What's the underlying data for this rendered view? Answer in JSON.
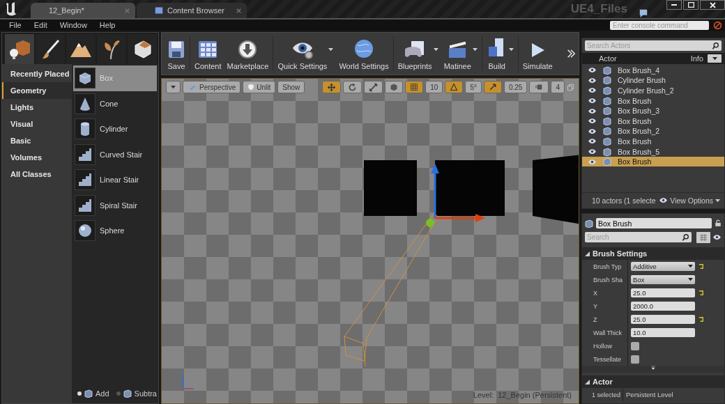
{
  "window": {
    "tabs": [
      {
        "label": "12_Begin*",
        "kind": "level",
        "selected": true
      },
      {
        "label": "Content Browser",
        "kind": "content",
        "selected": false
      }
    ],
    "project": "UE4_Files"
  },
  "menu": [
    "File",
    "Edit",
    "Window",
    "Help"
  ],
  "console": {
    "placeholder": "Enter console command"
  },
  "modes": [
    {
      "kind": "place",
      "selected": true
    },
    {
      "kind": "paint",
      "selected": false
    },
    {
      "kind": "landscape",
      "selected": false
    },
    {
      "kind": "foliage",
      "selected": false
    },
    {
      "kind": "geometry",
      "selected": false
    }
  ],
  "place_categories": [
    {
      "label": "Recently Placed",
      "selected": false
    },
    {
      "label": "Geometry",
      "selected": true
    },
    {
      "label": "Lights",
      "selected": false
    },
    {
      "label": "Visual",
      "selected": false
    },
    {
      "label": "Basic",
      "selected": false
    },
    {
      "label": "Volumes",
      "selected": false
    },
    {
      "label": "All Classes",
      "selected": false
    }
  ],
  "place_items": [
    {
      "label": "Box",
      "kind": "box",
      "selected": true
    },
    {
      "label": "Cone",
      "kind": "cone",
      "selected": false
    },
    {
      "label": "Cylinder",
      "kind": "cylinder",
      "selected": false
    },
    {
      "label": "Curved Stair",
      "kind": "stair",
      "selected": false
    },
    {
      "label": "Linear Stair",
      "kind": "stair",
      "selected": false
    },
    {
      "label": "Spiral Stair",
      "kind": "stair",
      "selected": false
    },
    {
      "label": "Sphere",
      "kind": "sphere",
      "selected": false
    }
  ],
  "brush_modes": [
    {
      "label": "Add",
      "selected": true
    },
    {
      "label": "Subtra",
      "selected": false
    }
  ],
  "toolbar": [
    {
      "label": "Save",
      "kind": "save",
      "dropdown": false
    },
    {
      "label": "Content",
      "kind": "content",
      "dropdown": false
    },
    {
      "label": "Marketplace",
      "kind": "market",
      "dropdown": false
    },
    {
      "label": "Quick Settings",
      "kind": "settings",
      "dropdown": true
    },
    {
      "label": "World Settings",
      "kind": "globe",
      "dropdown": false
    },
    {
      "label": "Blueprints",
      "kind": "gamepad",
      "dropdown": true
    },
    {
      "label": "Matinee",
      "kind": "clapper",
      "dropdown": true
    },
    {
      "label": "Build",
      "kind": "build",
      "dropdown": true
    },
    {
      "label": "Simulate",
      "kind": "play",
      "dropdown": false
    }
  ],
  "viewport": {
    "view_buttons": [
      {
        "label": "Perspective",
        "kind": "perspective"
      },
      {
        "label": "Unlit",
        "kind": "unlit"
      },
      {
        "label": "Show",
        "kind": "plain"
      }
    ],
    "transform_modes": [
      {
        "kind": "translate",
        "selected": true
      },
      {
        "kind": "rotate",
        "selected": false
      },
      {
        "kind": "scale",
        "selected": false
      }
    ],
    "snaps": [
      {
        "kind": "grid",
        "value": "10",
        "on": true
      },
      {
        "kind": "rotate",
        "value": "5°",
        "on": true
      },
      {
        "kind": "scale",
        "value": "0.25",
        "on": true
      },
      {
        "kind": "camera",
        "value": "4",
        "on": false
      }
    ],
    "level_label": "Level:",
    "level": "12_Begin (Persistent)"
  },
  "outliner": {
    "search": {
      "placeholder": "Search Actors"
    },
    "columns": [
      "Actor",
      "Info"
    ],
    "rows": [
      {
        "label": "Box Brush_4",
        "selected": false
      },
      {
        "label": "Cylinder Brush",
        "selected": false
      },
      {
        "label": "Cylinder Brush_2",
        "selected": false
      },
      {
        "label": "Box Brush",
        "selected": false
      },
      {
        "label": "Box Brush_3",
        "selected": false
      },
      {
        "label": "Box Brush",
        "selected": false
      },
      {
        "label": "Box Brush_2",
        "selected": false
      },
      {
        "label": "Box Brush",
        "selected": false
      },
      {
        "label": "Box Brush_5",
        "selected": false
      },
      {
        "label": "Box Brush",
        "selected": true
      }
    ],
    "count": "10 actors (1 selecte",
    "view_options": "View Options"
  },
  "details": {
    "name": "Box Brush",
    "search": {
      "placeholder": "Search"
    },
    "sections": [
      {
        "title": "Brush Settings",
        "expanded": true,
        "properties": [
          {
            "label": "Brush Typ",
            "kind": "dropdown",
            "value": "Additive",
            "reset": true
          },
          {
            "label": "Brush Sha",
            "kind": "dropdown",
            "value": "Box",
            "reset": false
          },
          {
            "label": "X",
            "kind": "number",
            "value": "25.0",
            "reset": true
          },
          {
            "label": "Y",
            "kind": "number",
            "value": "2000.0",
            "reset": false
          },
          {
            "label": "Z",
            "kind": "number",
            "value": "25.0",
            "reset": true
          },
          {
            "label": "Wall Thick",
            "kind": "number",
            "value": "10.0",
            "reset": false
          },
          {
            "label": "Hollow",
            "kind": "checkbox",
            "checked": false,
            "reset": false
          },
          {
            "label": "Tessellate",
            "kind": "checkbox",
            "checked": false,
            "reset": false
          }
        ]
      },
      {
        "title": "Actor",
        "expanded": true,
        "properties": [
          {
            "label": "1 selected",
            "kind": "text",
            "value": "Persistent Level",
            "reset": false
          }
        ]
      }
    ]
  }
}
